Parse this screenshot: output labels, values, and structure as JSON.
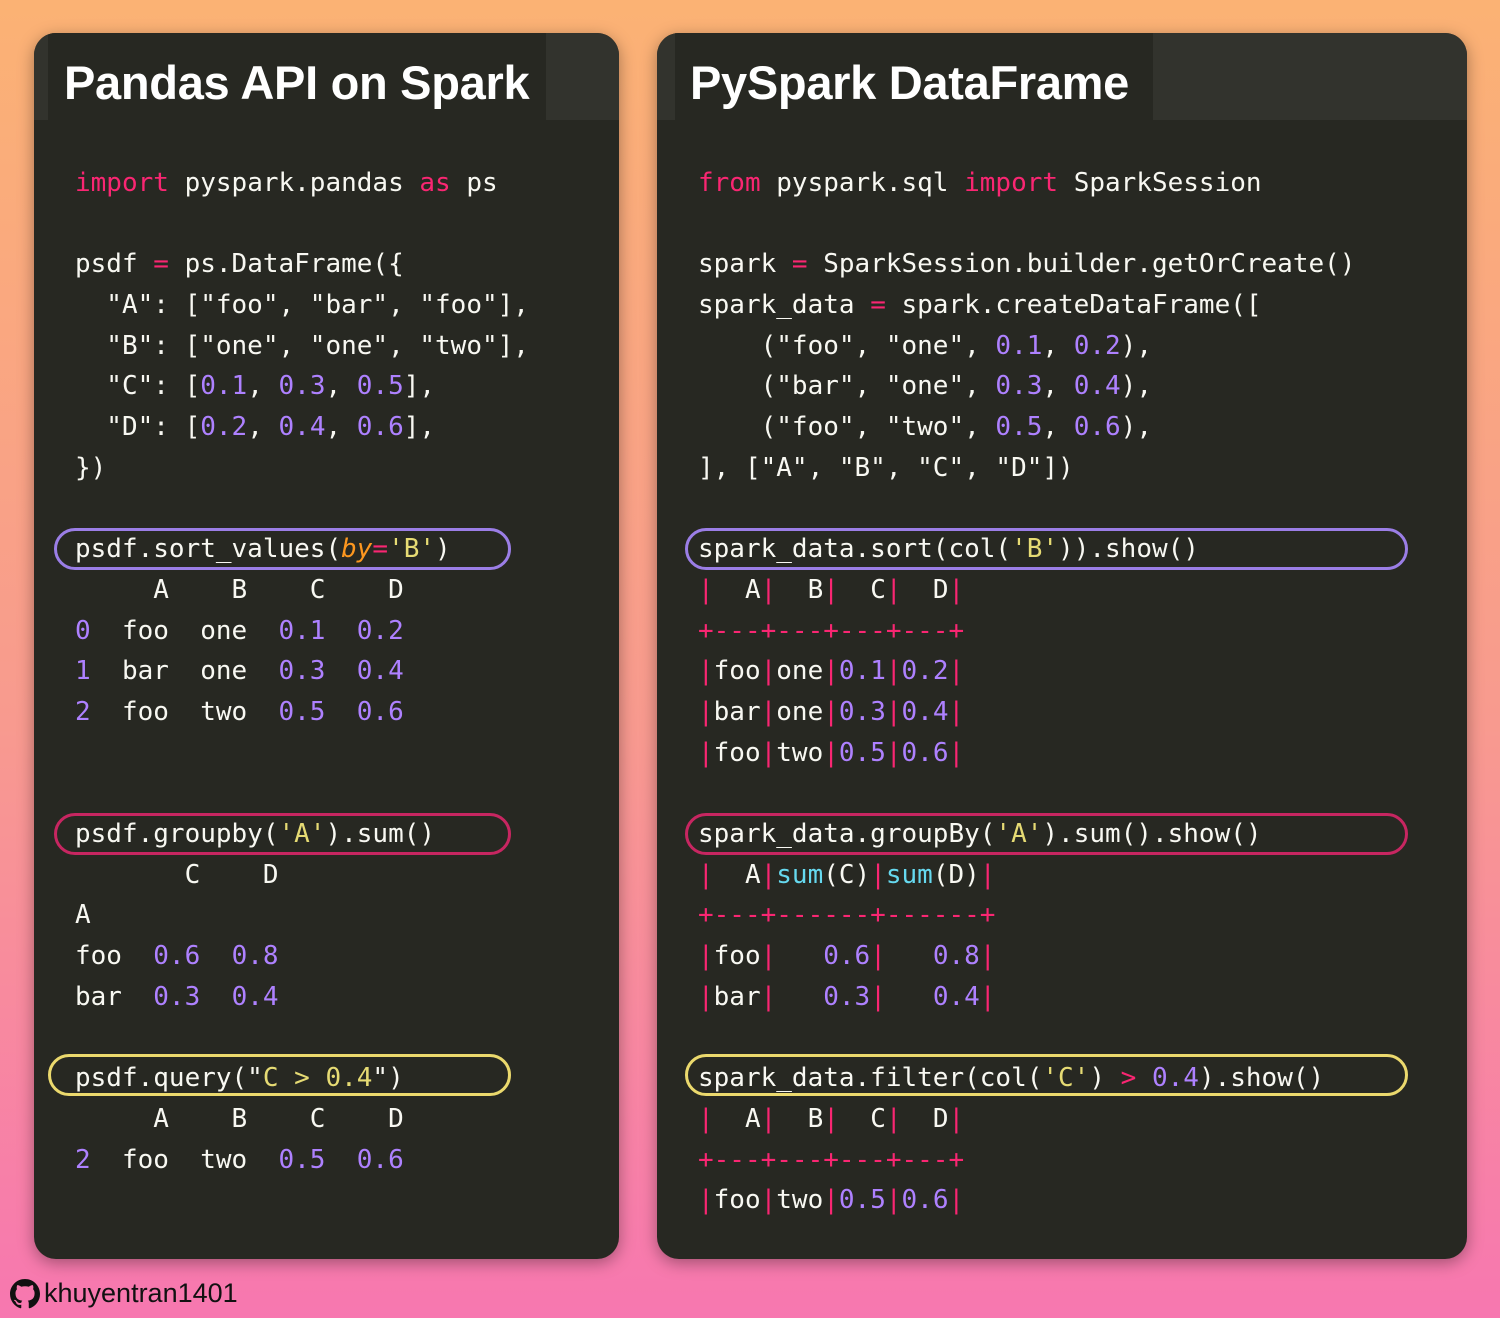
{
  "left": {
    "title": "Pandas API on Spark",
    "lines": [
      [
        [
          "k",
          "import"
        ],
        [
          "t",
          " pyspark.pandas "
        ],
        [
          "k",
          "as"
        ],
        [
          "t",
          " ps"
        ]
      ],
      [],
      [
        [
          "t",
          "psdf "
        ],
        [
          "k",
          "="
        ],
        [
          "t",
          " ps.DataFrame({"
        ]
      ],
      [
        [
          "t",
          "  \"A\": [\"foo\", \"bar\", \"foo\"],"
        ]
      ],
      [
        [
          "t",
          "  \"B\": [\"one\", \"one\", \"two\"],"
        ]
      ],
      [
        [
          "t",
          "  \"C\": ["
        ],
        [
          "n",
          "0.1"
        ],
        [
          "t",
          ", "
        ],
        [
          "n",
          "0.3"
        ],
        [
          "t",
          ", "
        ],
        [
          "n",
          "0.5"
        ],
        [
          "t",
          "],"
        ]
      ],
      [
        [
          "t",
          "  \"D\": ["
        ],
        [
          "n",
          "0.2"
        ],
        [
          "t",
          ", "
        ],
        [
          "n",
          "0.4"
        ],
        [
          "t",
          ", "
        ],
        [
          "n",
          "0.6"
        ],
        [
          "t",
          "],"
        ]
      ],
      [
        [
          "t",
          "})"
        ]
      ],
      [],
      [
        [
          "t",
          "psdf.sort_values("
        ],
        [
          "a",
          "by"
        ],
        [
          "k",
          "="
        ],
        [
          "s",
          "'B'"
        ],
        [
          "t",
          ")"
        ]
      ],
      [
        [
          "t",
          "     A    B    C    D"
        ]
      ],
      [
        [
          "n",
          "0"
        ],
        [
          "t",
          "  foo  one  "
        ],
        [
          "n",
          "0.1"
        ],
        [
          "t",
          "  "
        ],
        [
          "n",
          "0.2"
        ]
      ],
      [
        [
          "n",
          "1"
        ],
        [
          "t",
          "  bar  one  "
        ],
        [
          "n",
          "0.3"
        ],
        [
          "t",
          "  "
        ],
        [
          "n",
          "0.4"
        ]
      ],
      [
        [
          "n",
          "2"
        ],
        [
          "t",
          "  foo  two  "
        ],
        [
          "n",
          "0.5"
        ],
        [
          "t",
          "  "
        ],
        [
          "n",
          "0.6"
        ]
      ],
      [],
      [],
      [
        [
          "t",
          "psdf.groupby("
        ],
        [
          "s",
          "'A'"
        ],
        [
          "t",
          ").sum()"
        ]
      ],
      [
        [
          "t",
          "       C    D"
        ]
      ],
      [
        [
          "t",
          "A"
        ]
      ],
      [
        [
          "t",
          "foo  "
        ],
        [
          "n",
          "0.6"
        ],
        [
          "t",
          "  "
        ],
        [
          "n",
          "0.8"
        ]
      ],
      [
        [
          "t",
          "bar  "
        ],
        [
          "n",
          "0.3"
        ],
        [
          "t",
          "  "
        ],
        [
          "n",
          "0.4"
        ]
      ],
      [],
      [
        [
          "t",
          "psdf.query(\""
        ],
        [
          "s",
          "C > 0.4"
        ],
        [
          "t",
          "\")"
        ]
      ],
      [
        [
          "t",
          "     A    B    C    D"
        ]
      ],
      [
        [
          "n",
          "2"
        ],
        [
          "t",
          "  foo  two  "
        ],
        [
          "n",
          "0.5"
        ],
        [
          "t",
          "  "
        ],
        [
          "n",
          "0.6"
        ]
      ]
    ]
  },
  "right": {
    "title": "PySpark DataFrame",
    "lines": [
      [
        [
          "k",
          "from"
        ],
        [
          "t",
          " pyspark.sql "
        ],
        [
          "k",
          "import"
        ],
        [
          "t",
          " SparkSession"
        ]
      ],
      [],
      [
        [
          "t",
          "spark "
        ],
        [
          "k",
          "="
        ],
        [
          "t",
          " SparkSession.builder.getOrCreate()"
        ]
      ],
      [
        [
          "t",
          "spark_data "
        ],
        [
          "k",
          "="
        ],
        [
          "t",
          " spark.createDataFrame(["
        ]
      ],
      [
        [
          "t",
          "    (\"foo\", \"one\", "
        ],
        [
          "n",
          "0.1"
        ],
        [
          "t",
          ", "
        ],
        [
          "n",
          "0.2"
        ],
        [
          "t",
          "),"
        ]
      ],
      [
        [
          "t",
          "    (\"bar\", \"one\", "
        ],
        [
          "n",
          "0.3"
        ],
        [
          "t",
          ", "
        ],
        [
          "n",
          "0.4"
        ],
        [
          "t",
          "),"
        ]
      ],
      [
        [
          "t",
          "    (\"foo\", \"two\", "
        ],
        [
          "n",
          "0.5"
        ],
        [
          "t",
          ", "
        ],
        [
          "n",
          "0.6"
        ],
        [
          "t",
          "),"
        ]
      ],
      [
        [
          "t",
          "], [\"A\", \"B\", \"C\", \"D\"])"
        ]
      ],
      [],
      [
        [
          "t",
          "spark_data.sort(col("
        ],
        [
          "s",
          "'B'"
        ],
        [
          "t",
          ")).show()"
        ]
      ],
      [
        [
          "p",
          "|"
        ],
        [
          "t",
          "  A"
        ],
        [
          "p",
          "|"
        ],
        [
          "t",
          "  B"
        ],
        [
          "p",
          "|"
        ],
        [
          "t",
          "  C"
        ],
        [
          "p",
          "|"
        ],
        [
          "t",
          "  D"
        ],
        [
          "p",
          "|"
        ]
      ],
      [
        [
          "p",
          "+---+---+---+---+"
        ]
      ],
      [
        [
          "p",
          "|"
        ],
        [
          "t",
          "foo"
        ],
        [
          "p",
          "|"
        ],
        [
          "t",
          "one"
        ],
        [
          "p",
          "|"
        ],
        [
          "n",
          "0.1"
        ],
        [
          "p",
          "|"
        ],
        [
          "n",
          "0.2"
        ],
        [
          "p",
          "|"
        ]
      ],
      [
        [
          "p",
          "|"
        ],
        [
          "t",
          "bar"
        ],
        [
          "p",
          "|"
        ],
        [
          "t",
          "one"
        ],
        [
          "p",
          "|"
        ],
        [
          "n",
          "0.3"
        ],
        [
          "p",
          "|"
        ],
        [
          "n",
          "0.4"
        ],
        [
          "p",
          "|"
        ]
      ],
      [
        [
          "p",
          "|"
        ],
        [
          "t",
          "foo"
        ],
        [
          "p",
          "|"
        ],
        [
          "t",
          "two"
        ],
        [
          "p",
          "|"
        ],
        [
          "n",
          "0.5"
        ],
        [
          "p",
          "|"
        ],
        [
          "n",
          "0.6"
        ],
        [
          "p",
          "|"
        ]
      ],
      [],
      [
        [
          "t",
          "spark_data.groupBy("
        ],
        [
          "s",
          "'A'"
        ],
        [
          "t",
          ").sum().show()"
        ]
      ],
      [
        [
          "p",
          "|"
        ],
        [
          "t",
          "  A"
        ],
        [
          "p",
          "|"
        ],
        [
          "b",
          "sum"
        ],
        [
          "t",
          "(C)"
        ],
        [
          "p",
          "|"
        ],
        [
          "b",
          "sum"
        ],
        [
          "t",
          "(D)"
        ],
        [
          "p",
          "|"
        ]
      ],
      [
        [
          "p",
          "+---+------+------+"
        ]
      ],
      [
        [
          "p",
          "|"
        ],
        [
          "t",
          "foo"
        ],
        [
          "p",
          "|"
        ],
        [
          "t",
          "   "
        ],
        [
          "n",
          "0.6"
        ],
        [
          "p",
          "|"
        ],
        [
          "t",
          "   "
        ],
        [
          "n",
          "0.8"
        ],
        [
          "p",
          "|"
        ]
      ],
      [
        [
          "p",
          "|"
        ],
        [
          "t",
          "bar"
        ],
        [
          "p",
          "|"
        ],
        [
          "t",
          "   "
        ],
        [
          "n",
          "0.3"
        ],
        [
          "p",
          "|"
        ],
        [
          "t",
          "   "
        ],
        [
          "n",
          "0.4"
        ],
        [
          "p",
          "|"
        ]
      ],
      [],
      [
        [
          "t",
          "spark_data.filter(col("
        ],
        [
          "s",
          "'C'"
        ],
        [
          "t",
          ") "
        ],
        [
          "k",
          ">"
        ],
        [
          "t",
          " "
        ],
        [
          "n",
          "0.4"
        ],
        [
          "t",
          ").show()"
        ]
      ],
      [
        [
          "p",
          "|"
        ],
        [
          "t",
          "  A"
        ],
        [
          "p",
          "|"
        ],
        [
          "t",
          "  B"
        ],
        [
          "p",
          "|"
        ],
        [
          "t",
          "  C"
        ],
        [
          "p",
          "|"
        ],
        [
          "t",
          "  D"
        ],
        [
          "p",
          "|"
        ]
      ],
      [
        [
          "p",
          "+---+---+---+---+"
        ]
      ],
      [
        [
          "p",
          "|"
        ],
        [
          "t",
          "foo"
        ],
        [
          "p",
          "|"
        ],
        [
          "t",
          "two"
        ],
        [
          "p",
          "|"
        ],
        [
          "n",
          "0.5"
        ],
        [
          "p",
          "|"
        ],
        [
          "n",
          "0.6"
        ],
        [
          "p",
          "|"
        ]
      ]
    ]
  },
  "footer": {
    "icon": "github-icon",
    "username": "khuyentran1401"
  },
  "colors": {
    "keyword": "#f92672",
    "number": "#ae81ff",
    "string": "#e6db74",
    "argument": "#fd971f",
    "builtin": "#66d9ef",
    "highlight_purple": "#9b7ee6",
    "highlight_red": "#c72661",
    "highlight_yellow": "#ebd96d"
  }
}
